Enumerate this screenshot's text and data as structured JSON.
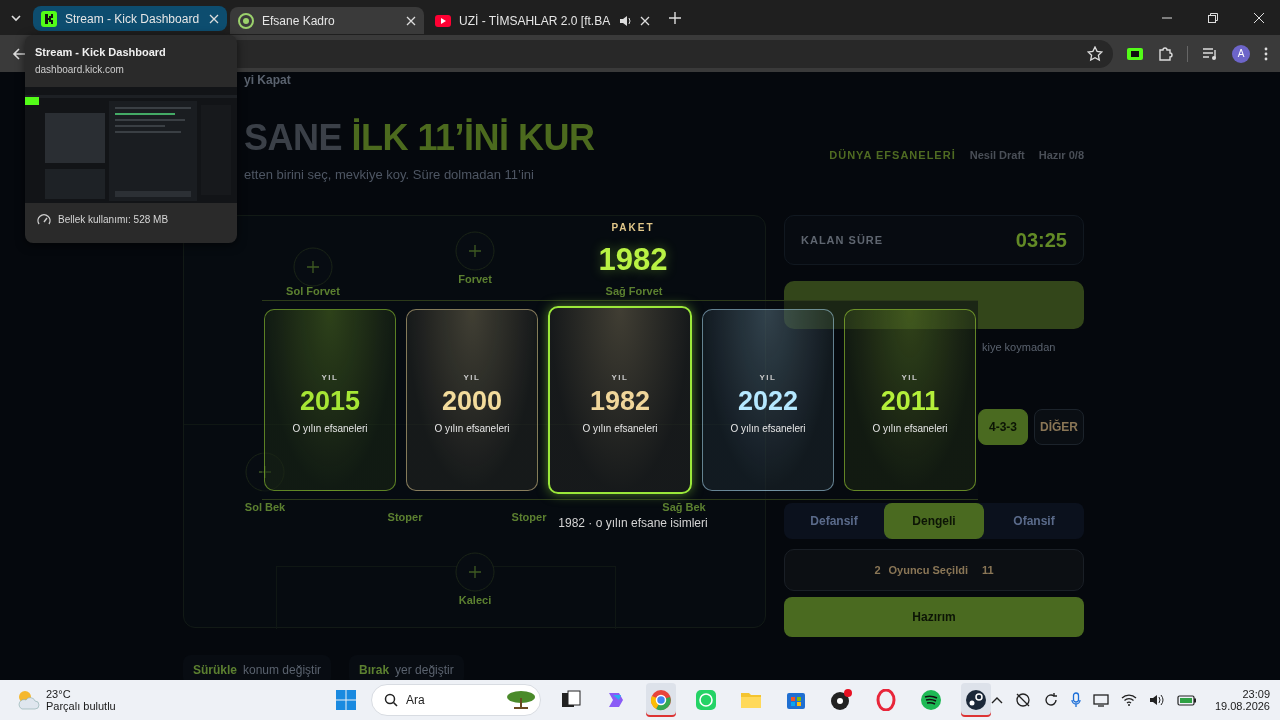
{
  "browser": {
    "tabs": [
      {
        "title": "Stream - Kick Dashboard",
        "kind": "kick",
        "selected": false,
        "hovered": true,
        "playing": false
      },
      {
        "title": "Efsane Kadro",
        "kind": "app",
        "selected": true,
        "hovered": false,
        "playing": false
      },
      {
        "title": "UZİ - TİMSAHLAR 2.0 [ft.BA",
        "kind": "video",
        "selected": false,
        "hovered": false,
        "playing": true
      }
    ],
    "hover_card": {
      "title": "Stream - Kick Dashboard",
      "url": "dashboard.kick.com",
      "memory": "Bellek kullanımı: 528 MB"
    },
    "profile": "A"
  },
  "page": {
    "close_link": "yi Kapat",
    "title_parts": [
      "SANE",
      "İLK 11’İNİ KUR"
    ],
    "subtitle": "etten birini seç, mevkiye koy. Süre dolmadan 11’ini",
    "tags": [
      {
        "label": "DÜNYA EFSANELERİ",
        "kind": "accent"
      },
      {
        "label": "Nesil Draft",
        "kind": "plain"
      },
      {
        "label": "Hazır 0/8",
        "kind": "plain"
      }
    ],
    "pitch": {
      "nodes": [
        {
          "label": "Sol Forvet",
          "kind": "slot"
        },
        {
          "label": "Forvet",
          "kind": "slot"
        },
        {
          "label": "Sağ Forvet",
          "kind": "label"
        },
        {
          "label": "Sol Bek",
          "kind": "slot"
        },
        {
          "label": "Stoper",
          "kind": "label"
        },
        {
          "label": "Stoper",
          "kind": "label"
        },
        {
          "label": "Sağ Bek",
          "kind": "label"
        },
        {
          "label": "Kaleci",
          "kind": "slot"
        }
      ]
    },
    "side": {
      "timer": {
        "label": "KALAN SÜRE",
        "value": "03:25"
      },
      "note": "kiye koymadan",
      "formations": [
        {
          "label": "4-3-3",
          "selected": true
        },
        {
          "label": "DİĞER",
          "selected": false
        }
      ],
      "styles": [
        {
          "label": "Defansif",
          "selected": false
        },
        {
          "label": "Dengeli",
          "selected": true
        },
        {
          "label": "Ofansif",
          "selected": false
        }
      ],
      "selection": {
        "count": "2",
        "label": "Oyuncu Seçildi",
        "total": "11"
      },
      "ready": "Hazırım"
    },
    "hints": [
      {
        "key": "Sürükle",
        "text": "konum değiştir"
      },
      {
        "key": "Bırak",
        "text": "yer değiştir"
      }
    ],
    "overlay": {
      "pack_label": "PAKET",
      "pack_year": "1982",
      "cards": [
        {
          "label": "YIL",
          "year": "2015",
          "caption": "O yılın efsaneleri",
          "color": "#a6e635",
          "selected": false
        },
        {
          "label": "YIL",
          "year": "2000",
          "caption": "O yılın efsaneleri",
          "color": "#f3dc9c",
          "selected": false
        },
        {
          "label": "YIL",
          "year": "1982",
          "caption": "O yılın efsaneleri",
          "color": "#f0d69a",
          "selected": true
        },
        {
          "label": "YIL",
          "year": "2022",
          "caption": "O yılın efsaneleri",
          "color": "#b5e8ff",
          "selected": false
        },
        {
          "label": "YIL",
          "year": "2011",
          "caption": "O yılın efsaneleri",
          "color": "#b4f03a",
          "selected": false
        }
      ],
      "footer": "1982 · o yılın efsane isimleri"
    }
  },
  "taskbar": {
    "weather": {
      "temp": "23°C",
      "desc": "Parçalı bulutlu"
    },
    "search": {
      "placeholder": "Ara"
    },
    "apps": [
      {
        "kind": "grid",
        "active": false
      },
      {
        "kind": "copilot",
        "active": false
      },
      {
        "kind": "browser",
        "active": true
      },
      {
        "kind": "chat",
        "active": false
      },
      {
        "kind": "folder",
        "active": false
      },
      {
        "kind": "store",
        "active": false
      },
      {
        "kind": "record",
        "active": false
      },
      {
        "kind": "ring",
        "active": false
      },
      {
        "kind": "music",
        "active": false
      },
      {
        "kind": "game",
        "active": true
      }
    ],
    "clock": {
      "time": "23:09",
      "date": "19.08.2026"
    }
  }
}
